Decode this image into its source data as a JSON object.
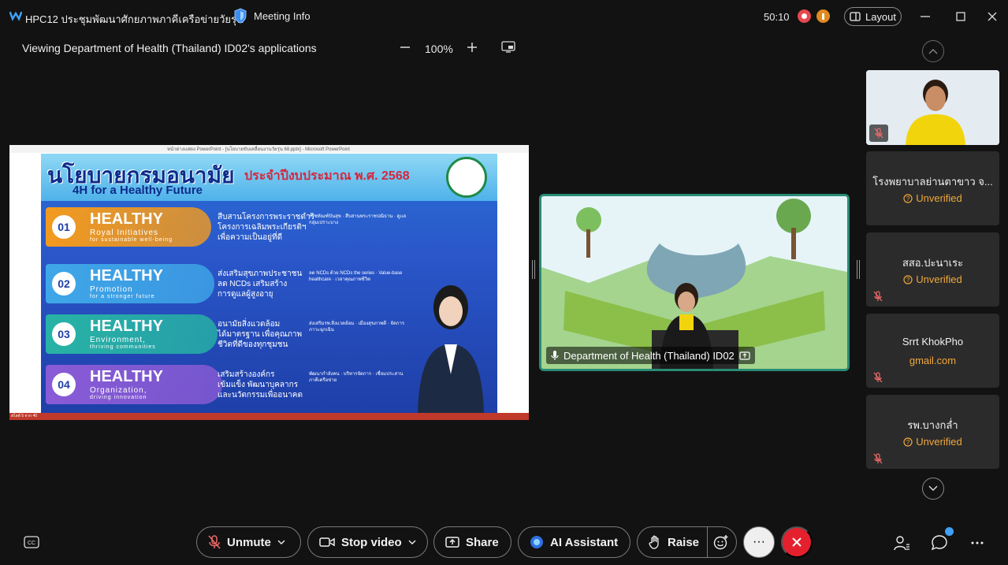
{
  "app": {
    "meeting_title": "HPC12 ประชุมพัฒนาศักยภาพภาคีเครือข่ายวัยรุ่น",
    "meeting_info_label": "Meeting Info",
    "timer": "50:10",
    "layout_label": "Layout"
  },
  "viewbar": {
    "title": "Viewing Department of Health (Thailand) ID02's applications",
    "zoom": "100%"
  },
  "share": {
    "window_title": "หน้าต่างแสดง PowerPoint - [นโยบายขับเคลื่อนงานวัยรุ่น 68.pptx] - Microsoft PowerPoint",
    "status_text": "สไลด์ 5 จาก 40",
    "slide": {
      "title": "นโยบายกรมอนามัย",
      "subtitle": "4H for a Healthy Future",
      "year": "ประจำปีงบประมาณ พ.ศ. 2568",
      "pillars": [
        {
          "num": "01",
          "name": "HEALTHY",
          "tag": "Royal Initiatives",
          "tag2": "for sustainable well-being",
          "desc": "สืบสานโครงการพระราชดำริ\nโครงการเฉลิมพระเกียรติฯ\nเพื่อความเป็นอยู่ที่ดี",
          "notes": "ราชทัณฑ์ปันสุข · สืบสานพระราชปณิธาน · ดูแลกลุ่มเปราะบาง",
          "color": "#f39a1e"
        },
        {
          "num": "02",
          "name": "HEALTHY",
          "tag": "Promotion",
          "tag2": "for a stronger future",
          "desc": "ส่งเสริมสุขภาพประชาชน\nลด NCDs เสริมสร้าง\nการดูแลผู้สูงอายุ",
          "notes": "ลด NCDs ด้วย NCDs the series · Value-base healthcare · เวลาคุณภาพชีวิต",
          "color": "#3fa7e8"
        },
        {
          "num": "03",
          "name": "HEALTHY",
          "tag": "Environment,",
          "tag2": "thriving communities",
          "desc": "อนามัยสิ่งแวดล้อม\nได้มาตรฐาน เพื่อคุณภาพ\nชีวิตที่ดีของทุกชุมชน",
          "notes": "ส่งเสริมรพ.สิ่งแวดล้อม · เมืองสุขภาพดี · จัดการภาวะฉุกเฉิน",
          "color": "#27b3a5"
        },
        {
          "num": "04",
          "name": "HEALTHY",
          "tag": "Organization,",
          "tag2": "driving innovation",
          "desc": "เสริมสร้างองค์กร\nเข้มแข็ง พัฒนาบุคลากร\nและนวัตกรรมเพื่ออนาคต",
          "notes": "พัฒนากำลังคน · บริหารจัดการ · เชื่อมประสานภาคีเครือข่าย",
          "color": "#8a5bd6"
        }
      ]
    }
  },
  "video": {
    "caption": "Department of Health (Thailand) ID02"
  },
  "participants": [
    {
      "name": "โรงพยาบาลย่านตาขาว จ...",
      "status": "Unverified",
      "status_type": "unverified",
      "muted": false
    },
    {
      "name": "สสอ.ปะนาเระ",
      "status": "Unverified",
      "status_type": "unverified",
      "muted": true
    },
    {
      "name": "Srrt KhokPho",
      "status": "gmail.com",
      "status_type": "domain",
      "muted": true
    },
    {
      "name": "รพ.บางกล่ำ",
      "status": "Unverified",
      "status_type": "unverified",
      "muted": true
    }
  ],
  "toolbar": {
    "unmute": "Unmute",
    "stop_video": "Stop video",
    "share": "Share",
    "ai_assistant": "AI Assistant",
    "raise": "Raise",
    "more": "···"
  },
  "colors": {
    "accent": "#2a8b74",
    "warning": "#f0a83c",
    "end_call": "#e5202e",
    "badge": "#3fa0f5"
  }
}
